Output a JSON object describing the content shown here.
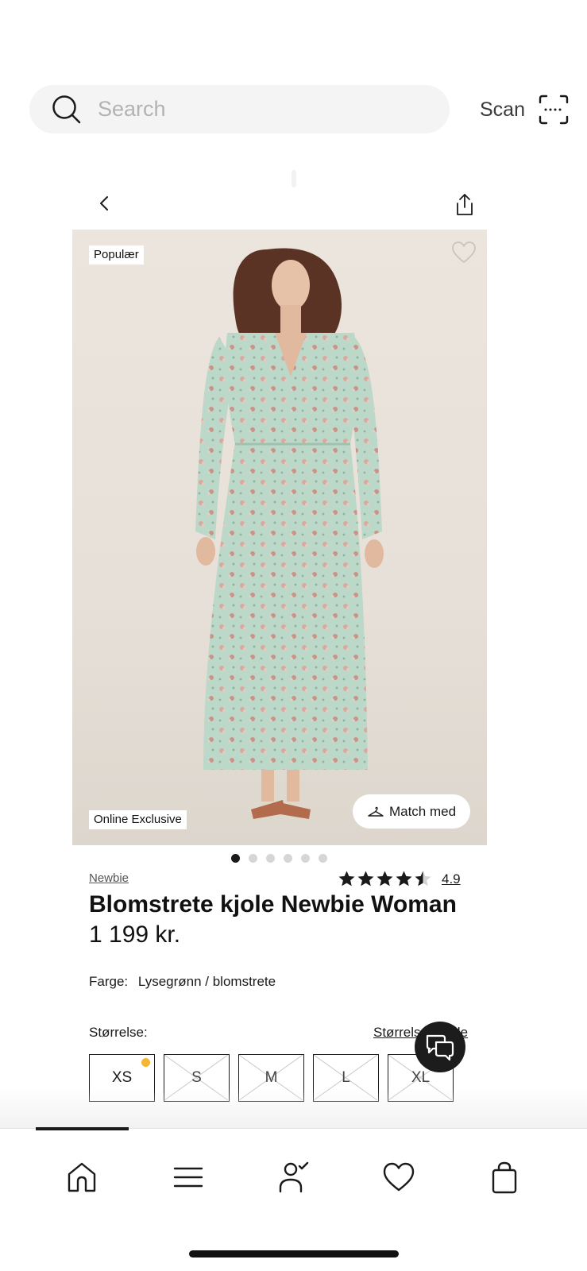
{
  "search": {
    "placeholder": "Search",
    "icon": "search-icon"
  },
  "scan": {
    "label": "Scan",
    "icon": "scan-icon"
  },
  "nav": {
    "back_icon": "chevron-left-icon",
    "share_icon": "share-icon"
  },
  "product": {
    "badges": {
      "popular": "Populær",
      "exclusive": "Online Exclusive"
    },
    "match_label": "Match med",
    "image_count": 6,
    "active_image": 1,
    "brand": "Newbie",
    "rating": {
      "value": "4.9",
      "stars": 4.5
    },
    "title": "Blomstrete kjole Newbie Woman",
    "price": "1 199 kr.",
    "color_label": "Farge:",
    "color_value": "Lysegrønn / blomstrete",
    "size_label": "Størrelse:",
    "size_guide_label": "Størrelsesguide",
    "sizes": [
      {
        "label": "XS",
        "available": true,
        "low_stock": true
      },
      {
        "label": "S",
        "available": false
      },
      {
        "label": "M",
        "available": false
      },
      {
        "label": "L",
        "available": false
      },
      {
        "label": "XL",
        "available": false
      }
    ]
  },
  "colors": {
    "text": "#1a1a1a",
    "stock_dot": "#f5b731",
    "fab": "#1c1c1c",
    "dress": "#bcd8c8"
  },
  "tabbar": {
    "items": [
      {
        "icon": "home-icon",
        "active": true
      },
      {
        "icon": "menu-icon"
      },
      {
        "icon": "account-icon"
      },
      {
        "icon": "heart-icon"
      },
      {
        "icon": "bag-icon"
      }
    ]
  }
}
